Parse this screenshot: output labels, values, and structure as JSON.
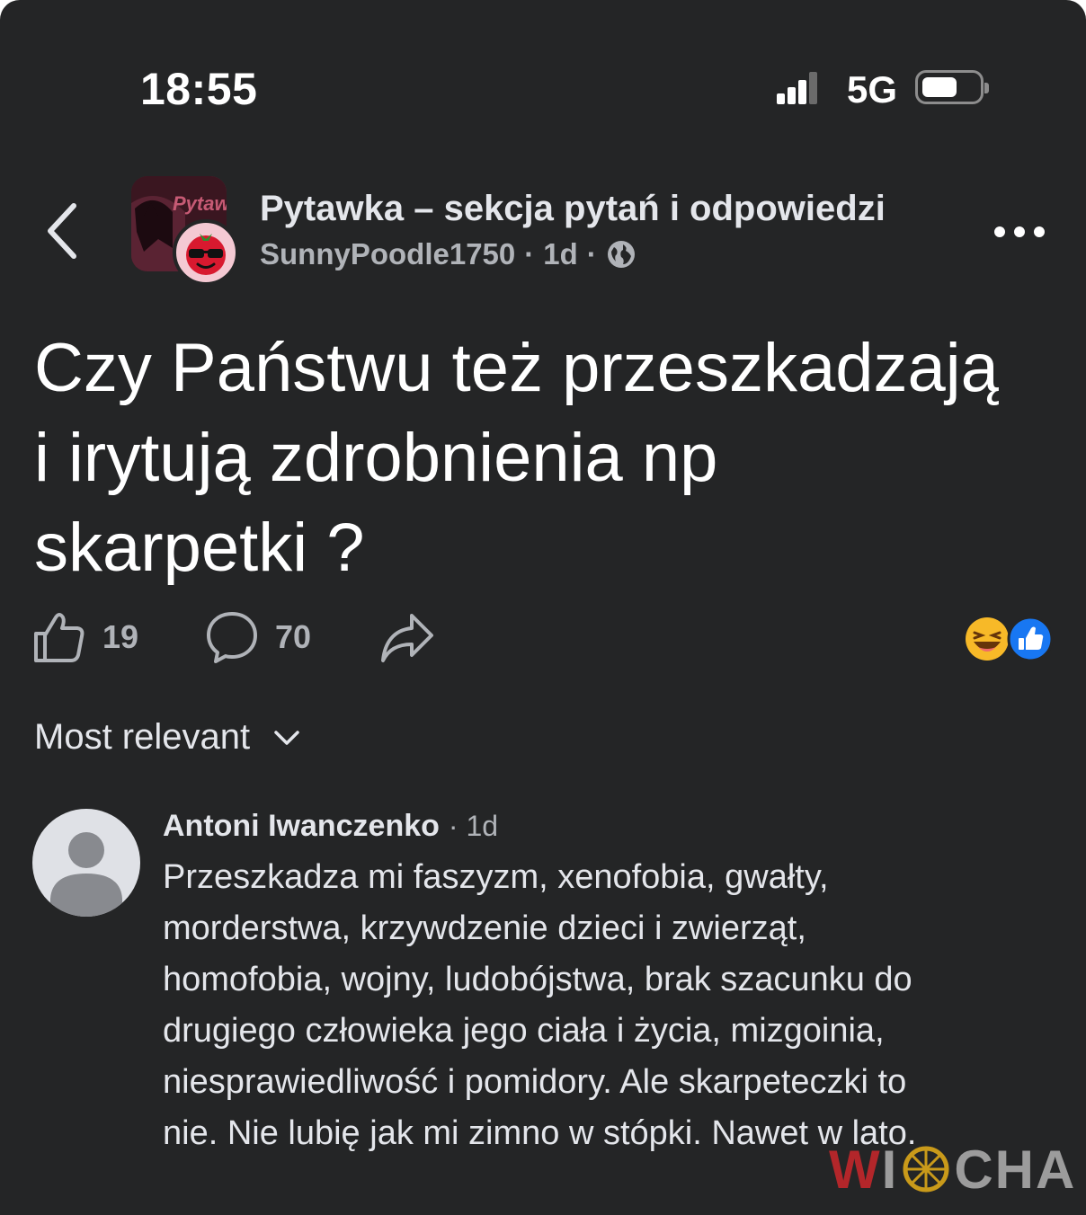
{
  "status_bar": {
    "time": "18:55",
    "network": "5G",
    "signal_bars_active": 3,
    "battery_level": 0.5
  },
  "header": {
    "back_icon": "chevron-left-icon",
    "group_name": "Pytawka – sekcja pytań i odpowiedzi",
    "group_thumb_text": "Pytaw",
    "author": "SunnyPoodle1750",
    "separator": "·",
    "age": "1d",
    "privacy_icon": "globe-icon",
    "more_icon": "more-horizontal-icon"
  },
  "post": {
    "title_lines": [
      "Czy Państwu też przeszkadzają",
      "i irytują zdrobnienia np",
      "skarpetki ?"
    ],
    "likes": "19",
    "comments": "70",
    "reactions": [
      "haha-icon",
      "like-icon"
    ]
  },
  "sort": {
    "label": "Most relevant"
  },
  "comment": {
    "author": "Antoni Iwanczenko",
    "time": "· 1d",
    "text_lines": [
      "Przeszkadza mi faszyzm, xenofobia, gwałty,",
      "morderstwa, krzywdzenie dzieci i zwierząt,",
      "homofobia, wojny, ludobójstwa, brak szacunku do",
      "drugiego człowieka jego ciała i życia, mizgoinia,",
      "niesprawiedliwość i pomidory. Ale skarpeteczki to",
      "nie. Nie lubię jak mi zimno w stópki. Nawet w lato."
    ]
  },
  "watermark": {
    "text": "WIOCHA"
  },
  "colors": {
    "background": "#242526",
    "text_primary": "#e4e6eb",
    "text_secondary": "#b0b3b8",
    "like_blue": "#1877f2",
    "watermark_red": "#b3262a"
  }
}
